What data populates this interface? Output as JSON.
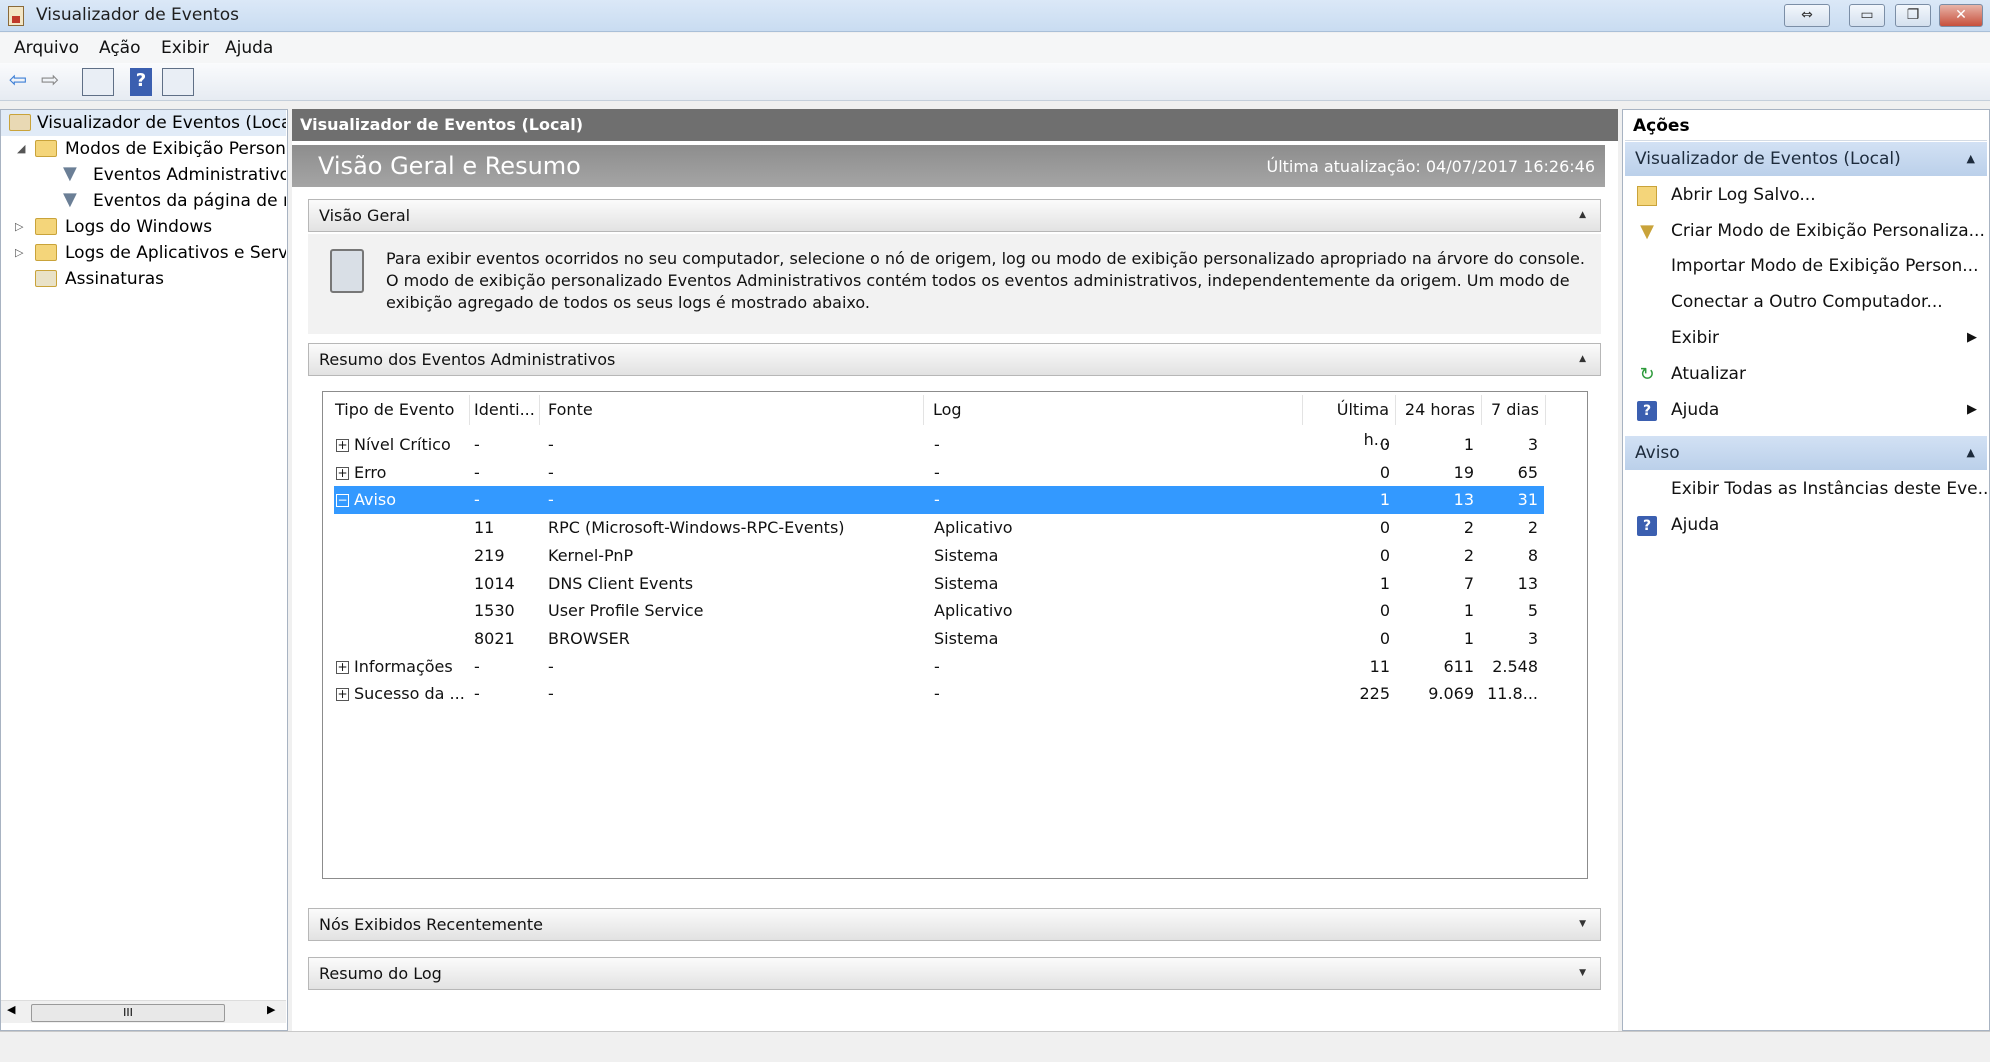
{
  "window": {
    "title": "Visualizador de Eventos",
    "restore_glyph": "⇔",
    "minimize_glyph": "▭",
    "maximize_glyph": "❐",
    "close_glyph": "✕"
  },
  "menu": [
    "Arquivo",
    "Ação",
    "Exibir",
    "Ajuda"
  ],
  "toolbar": {
    "back_icon": "back-arrow-icon",
    "forward_icon": "forward-arrow-icon",
    "back_glyph": "⇦",
    "forward_glyph": "⇨",
    "help_glyph": "?"
  },
  "tree": {
    "root": "Visualizador de Eventos (Local)",
    "custom_views": "Modos de Exibição Personali",
    "admin_events": "Eventos Administrativos",
    "page_events": "Eventos da página de res",
    "windows_logs": "Logs do Windows",
    "app_logs": "Logs de Aplicativos e Serviço",
    "subscriptions": "Assinaturas",
    "scroll_glyph": "III"
  },
  "center": {
    "header": "Visualizador de Eventos (Local)",
    "subheader": "Visão Geral e Resumo",
    "last_update": "Última atualização: 04/07/2017 16:26:46",
    "overview_title": "Visão Geral",
    "overview_text": "Para exibir eventos ocorridos no seu computador, selecione o nó de origem, log ou modo de exibição personalizado apropriado na árvore do console. O modo de exibição personalizado Eventos Administrativos contém todos os eventos administrativos, independentemente da origem. Um modo de exibição agregado de todos os seus logs é mostrado abaixo.",
    "summary_title": "Resumo dos Eventos Administrativos",
    "recent_title": "Nós Exibidos Recentemente",
    "log_summary_title": "Resumo do Log"
  },
  "table": {
    "headers": [
      "Tipo de Evento",
      "Identi...",
      "Fonte",
      "Log",
      "Última h...",
      "24 horas",
      "7 dias"
    ],
    "rows": [
      {
        "type": "Nível Crítico",
        "id": "-",
        "source": "-",
        "log": "-",
        "hour": "0",
        "day": "1",
        "week": "3",
        "expander": "+"
      },
      {
        "type": "Erro",
        "id": "-",
        "source": "-",
        "log": "-",
        "hour": "0",
        "day": "19",
        "week": "65",
        "expander": "+"
      },
      {
        "type": "Aviso",
        "id": "-",
        "source": "-",
        "log": "-",
        "hour": "1",
        "day": "13",
        "week": "31",
        "expander": "−"
      },
      {
        "type": "",
        "id": "11",
        "source": "RPC (Microsoft-Windows-RPC-Events)",
        "log": "Aplicativo",
        "hour": "0",
        "day": "2",
        "week": "2"
      },
      {
        "type": "",
        "id": "219",
        "source": "Kernel-PnP",
        "log": "Sistema",
        "hour": "0",
        "day": "2",
        "week": "8"
      },
      {
        "type": "",
        "id": "1014",
        "source": "DNS Client Events",
        "log": "Sistema",
        "hour": "1",
        "day": "7",
        "week": "13"
      },
      {
        "type": "",
        "id": "1530",
        "source": "User Profile Service",
        "log": "Aplicativo",
        "hour": "0",
        "day": "1",
        "week": "5"
      },
      {
        "type": "",
        "id": "8021",
        "source": "BROWSER",
        "log": "Sistema",
        "hour": "0",
        "day": "1",
        "week": "3"
      },
      {
        "type": "Informações",
        "id": "-",
        "source": "-",
        "log": "-",
        "hour": "11",
        "day": "611",
        "week": "2.548",
        "expander": "+"
      },
      {
        "type": "Sucesso da ...",
        "id": "-",
        "source": "-",
        "log": "-",
        "hour": "225",
        "day": "9.069",
        "week": "11.8...",
        "expander": "+"
      }
    ]
  },
  "actions": {
    "title": "Ações",
    "group1": "Visualizador de Eventos (Local)",
    "items1": [
      "Abrir Log Salvo...",
      "Criar Modo de Exibição Personaliza...",
      "Importar Modo de Exibição Person...",
      "Conectar a Outro Computador...",
      "Exibir",
      "Atualizar",
      "Ajuda"
    ],
    "group2": "Aviso",
    "items2": [
      "Exibir Todas as Instâncias deste Eve...",
      "Ajuda"
    ],
    "submenu_glyph": "▶",
    "collapse_glyph": "▲"
  },
  "colors": {
    "selection": "#3399ff",
    "header_bar": "#6f6f6f",
    "action_group": "#bbd0ea"
  }
}
